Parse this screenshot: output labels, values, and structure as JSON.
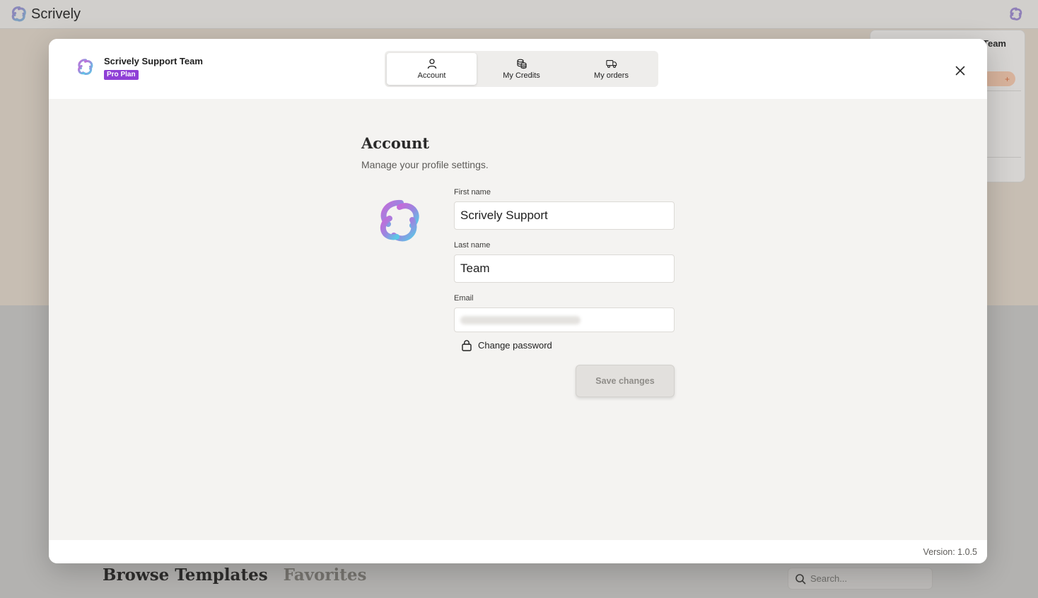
{
  "background": {
    "app_name": "Scrively",
    "dropdown_user_fragment": "Team",
    "credit_fragment": "+",
    "tabs": [
      "Browse Templates",
      "Favorites"
    ],
    "search_placeholder": "Search..."
  },
  "modal": {
    "user": {
      "name": "Scrively Support Team",
      "plan": "Pro Plan"
    },
    "tabs": [
      {
        "label": "Account",
        "icon": "user-icon",
        "active": true
      },
      {
        "label": "My Credits",
        "icon": "coins-icon",
        "active": false
      },
      {
        "label": "My orders",
        "icon": "truck-icon",
        "active": false
      }
    ],
    "title": "Account",
    "subtitle": "Manage your profile settings.",
    "form": {
      "first_name_label": "First name",
      "first_name_value": "Scrively Support",
      "last_name_label": "Last name",
      "last_name_value": "Team",
      "email_label": "Email",
      "change_password": "Change password",
      "save_label": "Save changes"
    },
    "version": "Version: 1.0.5"
  },
  "colors": {
    "plan_badge": "#8f3fd6",
    "logo_gradient_start": "#c56ad8",
    "logo_gradient_end": "#5ac8e6"
  }
}
